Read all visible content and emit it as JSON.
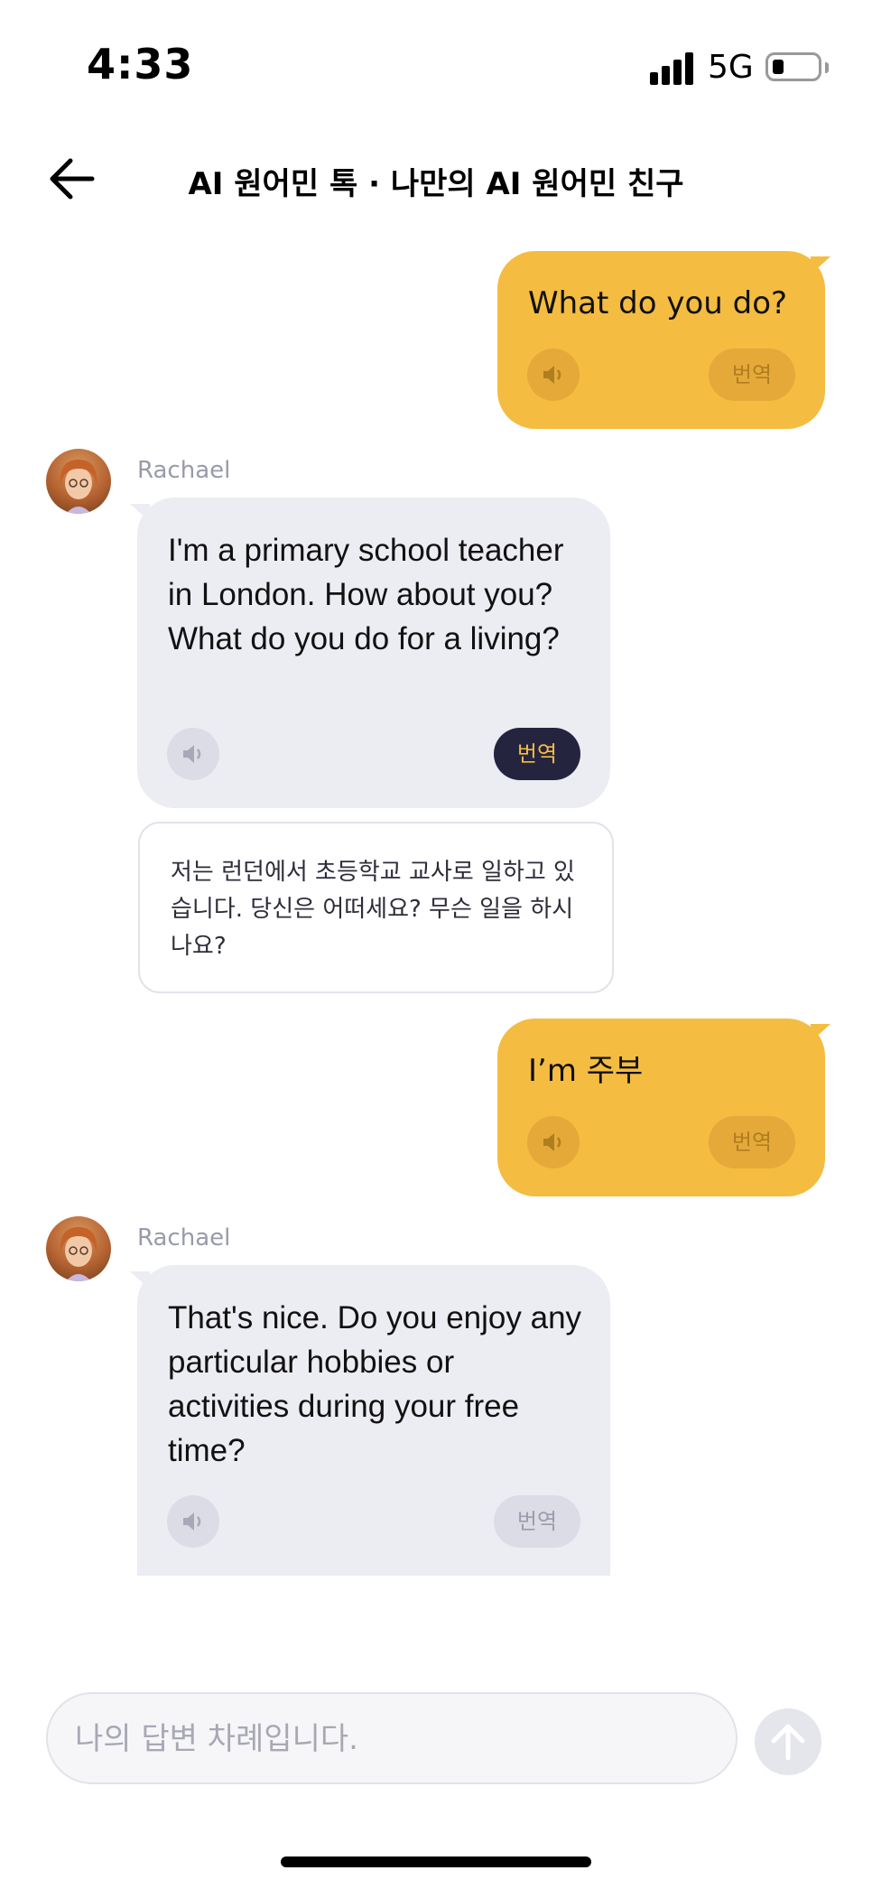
{
  "status_bar": {
    "time": "4:33",
    "network": "5G",
    "icons": [
      "signal-bars-icon",
      "battery-icon"
    ]
  },
  "header": {
    "title": "AI 원어민 톡 · 나만의 AI 원어민 친구",
    "back_icon": "arrow-left-icon"
  },
  "messages": [
    {
      "role": "user",
      "text": "What do you do?",
      "speaker_icon": "speaker-icon",
      "translate_label": "번역"
    },
    {
      "role": "ai",
      "sender": "Rachael",
      "text": "I'm a primary school teacher in London. How about you? What do you do for a living?",
      "speaker_icon": "speaker-icon",
      "translate_label": "번역",
      "translate_active": true,
      "translation": "저는 런던에서 초등학교 교사로 일하고 있습니다. 당신은 어떠세요? 무슨 일을 하시나요?"
    },
    {
      "role": "user",
      "text": "I’m 주부",
      "speaker_icon": "speaker-icon",
      "translate_label": "번역"
    },
    {
      "role": "ai",
      "sender": "Rachael",
      "text": "That's nice. Do you enjoy any particular hobbies or activities during your free time?",
      "speaker_icon": "speaker-icon",
      "translate_label": "번역",
      "translate_active": false
    }
  ],
  "composer": {
    "placeholder": "나의 답변 차례입니다.",
    "value": "",
    "send_icon": "arrow-up-icon"
  },
  "colors": {
    "user_bubble": "#F4BC41",
    "ai_bubble": "#ECECF3",
    "translate_active_bg": "#25243F",
    "translate_active_text": "#F4BC41"
  }
}
